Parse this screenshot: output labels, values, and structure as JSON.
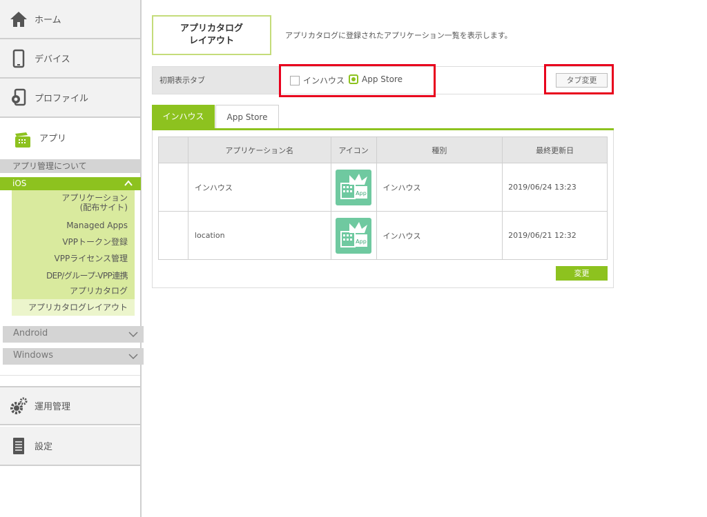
{
  "sidebar": {
    "home": "ホーム",
    "device": "デバイス",
    "profile": "プロファイル",
    "app": "アプリ",
    "app_about": "アプリ管理について",
    "ios": "iOS",
    "ios_items": [
      "アプリケーション\n(配布サイト)",
      "Managed Apps",
      "VPPトークン登録",
      "VPPライセンス管理",
      "DEP/グループ-VPP連携",
      "アプリカタログ"
    ],
    "ios_selected": "アプリカタログレイアウト",
    "android": "Android",
    "windows": "Windows",
    "operations": "運用管理",
    "settings": "設定"
  },
  "page": {
    "title": "アプリカタログ\nレイアウト",
    "description": "アプリカタログに登録されたアプリケーション一覧を表示します。"
  },
  "initial_tab": {
    "label": "初期表示タブ",
    "options": [
      "インハウス",
      "App Store"
    ],
    "selected": "App Store",
    "change_button": "タブ変更"
  },
  "tabs": [
    "インハウス",
    "App Store"
  ],
  "table": {
    "headers": [
      "",
      "アプリケーション名",
      "アイコン",
      "種別",
      "最終更新日"
    ],
    "rows": [
      {
        "name": "インハウス",
        "type": "インハウス",
        "updated": "2019/06/24 13:23"
      },
      {
        "name": "location",
        "type": "インハウス",
        "updated": "2019/06/21 12:32"
      }
    ],
    "icon_label": "App"
  },
  "change_button": "変更",
  "colors": {
    "accent": "#8dc21f",
    "highlight": "#e8001c"
  }
}
